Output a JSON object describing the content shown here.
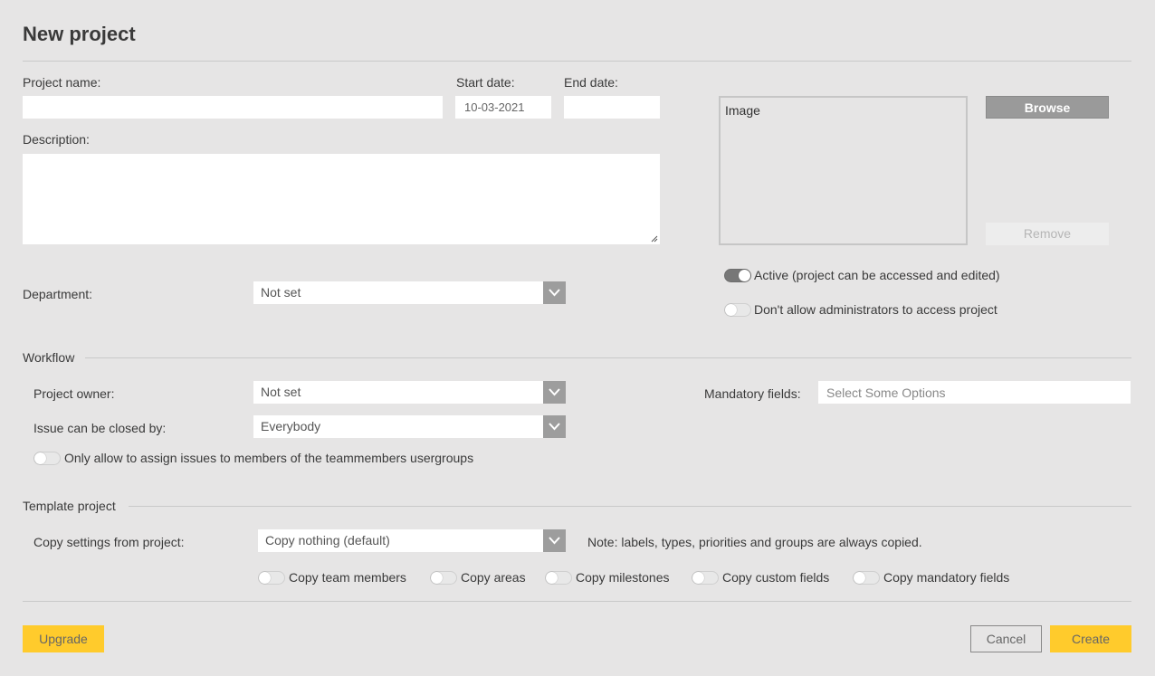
{
  "dialog": {
    "title": "New project"
  },
  "fields": {
    "project_name_label": "Project name:",
    "project_name_value": "",
    "start_date_label": "Start date:",
    "start_date_value": "10-03-2021",
    "end_date_label": "End date:",
    "end_date_value": "",
    "description_label": "Description:",
    "description_value": "",
    "department_label": "Department:",
    "department_value": "Not set"
  },
  "image": {
    "placeholder": "Image",
    "browse_label": "Browse",
    "remove_label": "Remove"
  },
  "toggles": {
    "active_label": "Active (project can be accessed and edited)",
    "active_on": true,
    "no_admin_label": "Don't allow administrators to access project",
    "no_admin_on": false
  },
  "workflow": {
    "section_label": "Workflow",
    "owner_label": "Project owner:",
    "owner_value": "Not set",
    "closed_by_label": "Issue can be closed by:",
    "closed_by_value": "Everybody",
    "mandatory_label": "Mandatory fields:",
    "mandatory_placeholder": "Select Some Options",
    "assign_toggle_label": "Only allow to assign issues to members of the teammembers usergroups",
    "assign_toggle_on": false
  },
  "template": {
    "section_label": "Template project",
    "copy_label": "Copy settings from project:",
    "copy_value": "Copy nothing (default)",
    "note": "Note: labels, types, priorities and groups are always copied.",
    "options": [
      {
        "label": "Copy team members",
        "on": false
      },
      {
        "label": "Copy areas",
        "on": false
      },
      {
        "label": "Copy milestones",
        "on": false
      },
      {
        "label": "Copy custom fields",
        "on": false
      },
      {
        "label": "Copy mandatory fields",
        "on": false
      }
    ]
  },
  "footer": {
    "upgrade_label": "Upgrade",
    "cancel_label": "Cancel",
    "create_label": "Create"
  },
  "colors": {
    "background": "#e6e5e5",
    "accent_yellow": "#ffcb2c",
    "button_gray": "#9a9a9a"
  }
}
